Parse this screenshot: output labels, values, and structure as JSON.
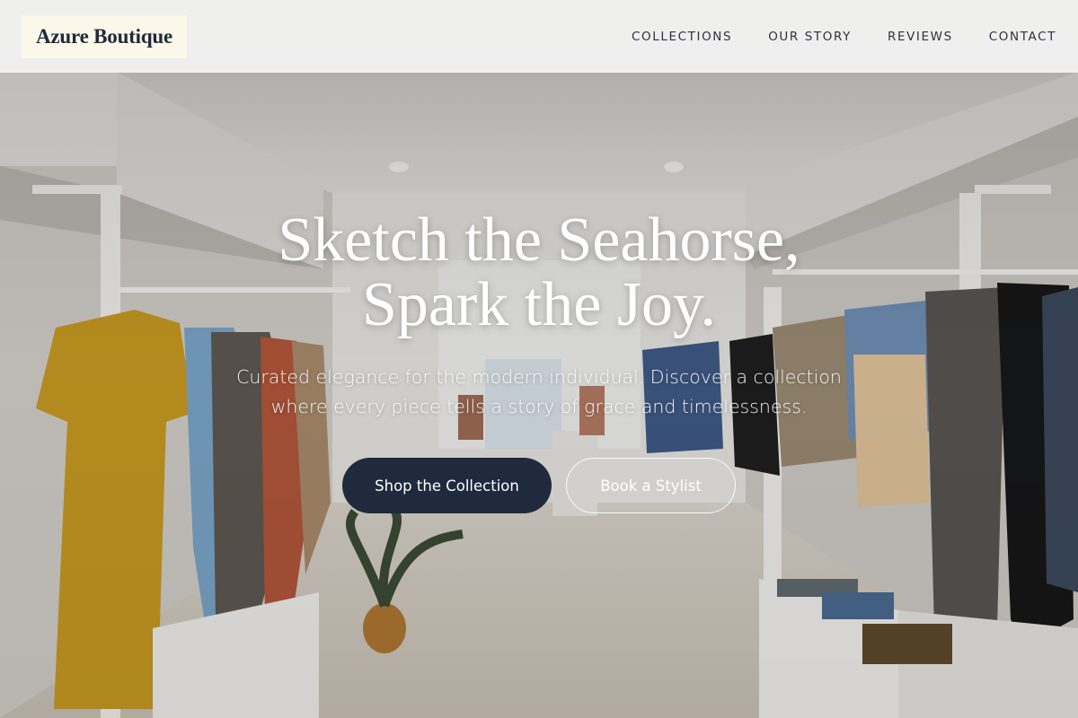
{
  "brand": {
    "name": "Azure Boutique"
  },
  "nav": {
    "items": [
      {
        "label": "COLLECTIONS"
      },
      {
        "label": "OUR STORY"
      },
      {
        "label": "REVIEWS"
      },
      {
        "label": "CONTACT"
      }
    ]
  },
  "hero": {
    "title_line1": "Sketch the Seahorse,",
    "title_line2": "Spark the Joy.",
    "subtitle": "Curated elegance for the modern individual. Discover a collection where every piece tells a story of grace and timelessness.",
    "primary_cta": "Shop the Collection",
    "secondary_cta": "Book a Stylist"
  },
  "colors": {
    "primary_button": "#1f2a3c",
    "logo_background": "#fbf8e9",
    "header_background": "#f3f3f3"
  }
}
